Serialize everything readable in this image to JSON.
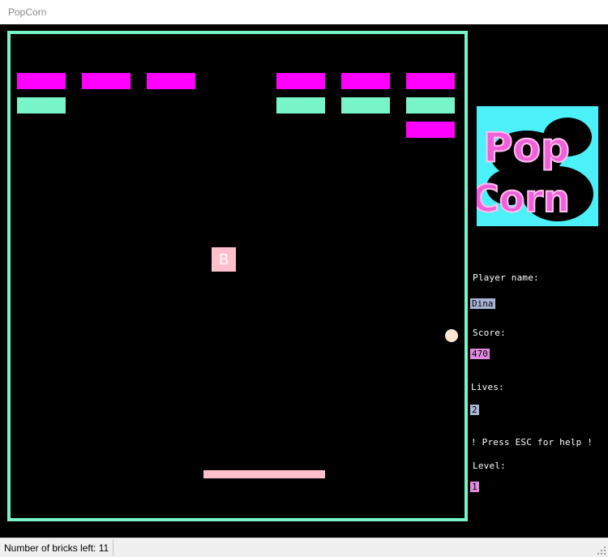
{
  "window": {
    "title": "PopCorn"
  },
  "colors": {
    "frame": "#78f5c8",
    "brick_magenta": "#ff00ff",
    "brick_mint": "#78f5c8",
    "paddle": "#ffc0cb",
    "ball": "#fce6d2",
    "name_bg": "#aab4d8",
    "score_bg": "#e38ae0",
    "lives_bg": "#aab4d8",
    "level_bg": "#e38ae0"
  },
  "board": {
    "bricks": [
      {
        "row": 0,
        "col": 0,
        "color": "magenta"
      },
      {
        "row": 0,
        "col": 1,
        "color": "magenta"
      },
      {
        "row": 0,
        "col": 2,
        "color": "magenta"
      },
      {
        "row": 0,
        "col": 4,
        "color": "magenta"
      },
      {
        "row": 0,
        "col": 5,
        "color": "magenta"
      },
      {
        "row": 0,
        "col": 6,
        "color": "magenta"
      },
      {
        "row": 1,
        "col": 0,
        "color": "mint"
      },
      {
        "row": 1,
        "col": 4,
        "color": "mint"
      },
      {
        "row": 1,
        "col": 5,
        "color": "mint"
      },
      {
        "row": 1,
        "col": 6,
        "color": "mint"
      },
      {
        "row": 2,
        "col": 6,
        "color": "magenta"
      }
    ],
    "bonus_letter": "B"
  },
  "logo": {
    "line1": "Pop",
    "line2": "Corn"
  },
  "hud": {
    "player_label": "Player name:",
    "player_name": "Dina",
    "score_label": "Score:",
    "score": "470",
    "lives_label": "Lives:",
    "lives": "2",
    "help_text": "! Press ESC for help !",
    "level_label": "Level:",
    "level": "1"
  },
  "status": {
    "bricks_left": "Number of bricks left: 11"
  }
}
